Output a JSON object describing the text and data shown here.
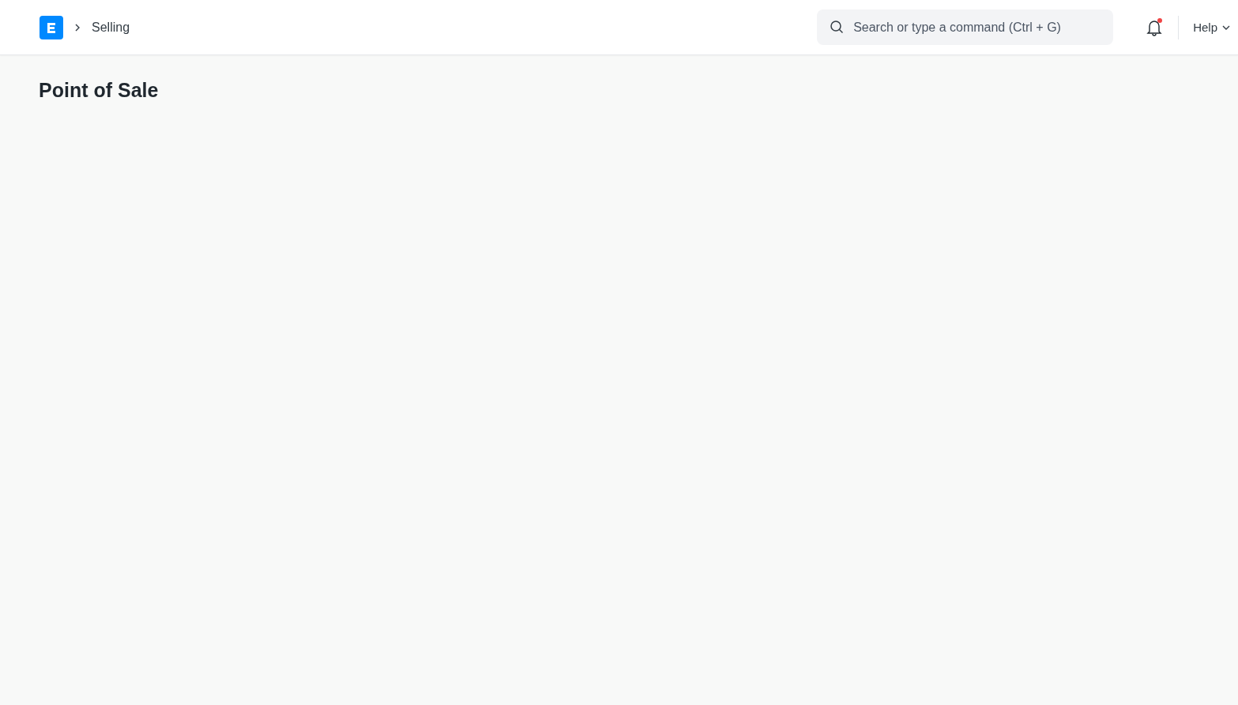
{
  "navbar": {
    "breadcrumbs": [
      "Selling"
    ],
    "search": {
      "placeholder": "Search or type a command (Ctrl + G)"
    },
    "notifications": {
      "unread": true
    },
    "help_menu": "Help"
  },
  "page": {
    "title": "Point of Sale"
  }
}
